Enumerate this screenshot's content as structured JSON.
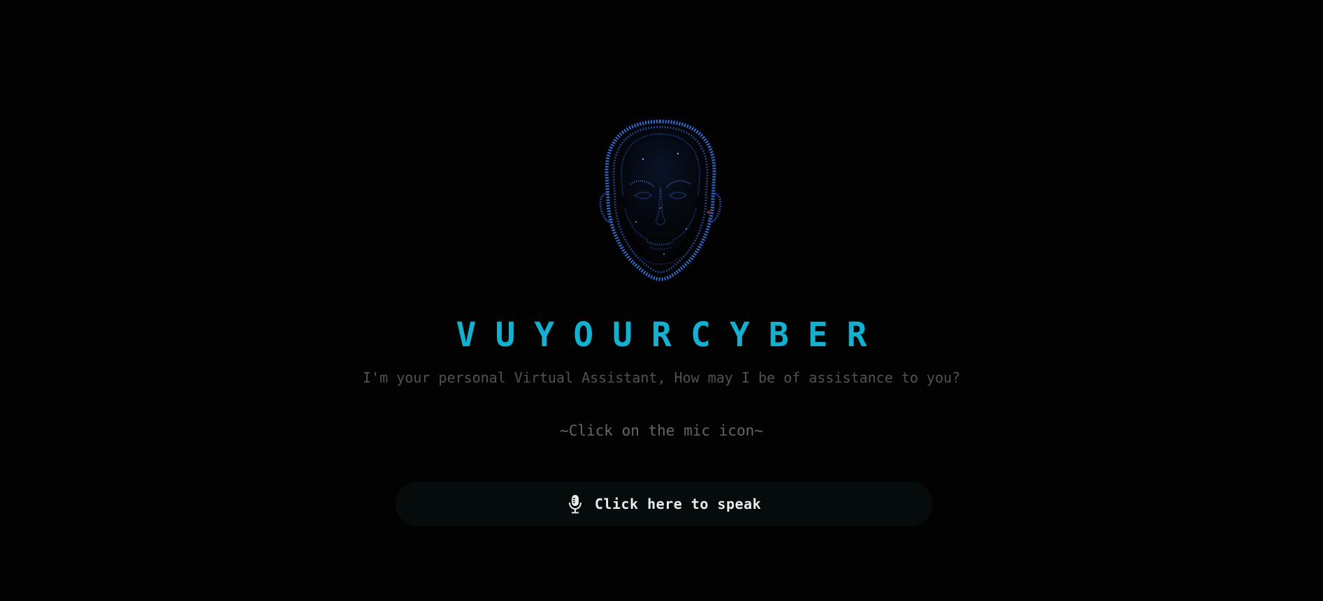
{
  "app": {
    "brand": "VUYOURCYBER",
    "tagline": "I'm your personal Virtual Assistant, How may I be of assistance to you?",
    "hint": "~Click on the mic icon~"
  },
  "speak_button": {
    "label": "Click here to speak",
    "icon": "microphone-icon"
  },
  "colors": {
    "background": "#020203",
    "accent": "#14b0cf",
    "button_bg": "#060c0b"
  }
}
